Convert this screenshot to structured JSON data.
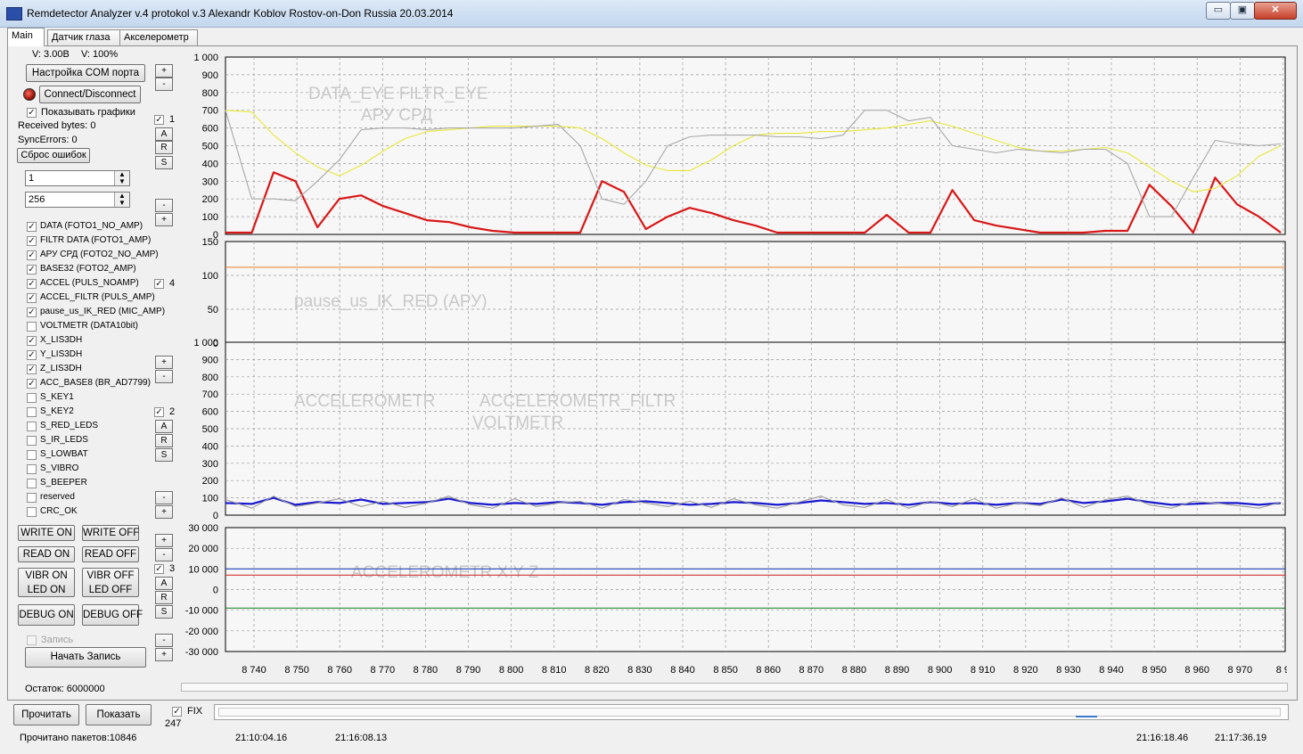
{
  "window": {
    "title": "Remdetector Analyzer v.4 protokol v.3 Alexandr Koblov Rostov-on-Don Russia 20.03.2014",
    "controls": [
      "▭",
      "▣",
      "✕"
    ]
  },
  "tabs": [
    {
      "label": "Main"
    },
    {
      "label": "Датчик глаза"
    },
    {
      "label": "Акселерометр"
    }
  ],
  "status_top": {
    "voltage": "V: 3.00В",
    "volume": "V: 100%"
  },
  "com_button": "Настройка COM порта",
  "connect_button": "Connect/Disconnect",
  "show_graphs": "Показывать графики",
  "received_bytes": "Received bytes: 0",
  "sync_errors": "SyncErrors: 0",
  "reset_errors": "Сброс ошибок",
  "spinners": [
    {
      "value": "1"
    },
    {
      "value": "256"
    }
  ],
  "channels": [
    {
      "label": "DATA (FOTO1_NO_AMP)",
      "checked": true
    },
    {
      "label": "FILTR DATA (FOTO1_AMP)",
      "checked": true
    },
    {
      "label": "АРУ СРД (FOTO2_NO_AMP)",
      "checked": true
    },
    {
      "label": "BASE32 (FOTO2_AMP)",
      "checked": true
    },
    {
      "label": "ACCEL (PULS_NOAMP)",
      "checked": true
    },
    {
      "label": "ACCEL_FILTR (PULS_AMP)",
      "checked": true
    },
    {
      "label": "pause_us_IK_RED (MIC_AMP)",
      "checked": true
    },
    {
      "label": "VOLTMETR (DATA10bit)",
      "checked": false
    },
    {
      "label": "X_LIS3DH",
      "checked": true
    },
    {
      "label": "Y_LIS3DH",
      "checked": true
    },
    {
      "label": "Z_LIS3DH",
      "checked": true
    },
    {
      "label": "ACC_BASE8 (BR_AD7799)",
      "checked": true
    },
    {
      "label": "S_KEY1",
      "checked": false
    },
    {
      "label": "S_KEY2",
      "checked": false
    },
    {
      "label": "S_RED_LEDS",
      "checked": false
    },
    {
      "label": "S_IR_LEDS",
      "checked": false
    },
    {
      "label": "S_LOWBAT",
      "checked": false
    },
    {
      "label": "S_VIBRO",
      "checked": false
    },
    {
      "label": "S_BEEPER",
      "checked": false
    },
    {
      "label": "reserved",
      "checked": false
    },
    {
      "label": "CRC_OK",
      "checked": false
    }
  ],
  "side_controls": {
    "plus": "+",
    "minus": "-",
    "a": "A",
    "r": "R",
    "s": "S",
    "num1": "1",
    "num4": "4",
    "num2": "2",
    "num3": "3"
  },
  "command_buttons": {
    "write_on": "WRITE ON",
    "write_off": "WRITE OFF",
    "read_on": "READ ON",
    "read_off": "READ OFF",
    "vibr_on": "VIBR ON",
    "vibr_off": "VIBR OFF",
    "led_on": "LED ON",
    "led_off": "LED OFF",
    "debug_on": "DEBUG ON",
    "debug_off": "DEBUG OFF"
  },
  "record": {
    "checkbox_label": "Запись",
    "start_button": "Начать Запись"
  },
  "remaining": "Остаток: 6000000",
  "bottom": {
    "read_button": "Прочитать",
    "show_button": "Показать",
    "fix_label": "FIX",
    "fix_value": "247",
    "packets": "Прочитано пакетов:10846",
    "time1": "21:10:04.16",
    "time2": "21:16:08.13",
    "time3": "21:16:18.46",
    "time4": "21:17:36.19"
  },
  "chart_data": [
    {
      "type": "line",
      "watermark": [
        "DATA_EYE   FILTR_EYE",
        "АРУ СРД"
      ],
      "ylim": [
        0,
        1000
      ],
      "yticks": [
        "1 000",
        "900",
        "800",
        "700",
        "600",
        "500",
        "400",
        "300",
        "200",
        "100",
        "0"
      ],
      "x": [
        8734,
        8740,
        8745,
        8750,
        8755,
        8760,
        8765,
        8770,
        8775,
        8780,
        8785,
        8790,
        8795,
        8800,
        8805,
        8810,
        8815,
        8820,
        8825,
        8830,
        8835,
        8840,
        8845,
        8850,
        8855,
        8860,
        8865,
        8870,
        8875,
        8880,
        8885,
        8890,
        8895,
        8900,
        8905,
        8910,
        8915,
        8920,
        8925,
        8930,
        8935,
        8940,
        8945,
        8950,
        8955,
        8960,
        8965,
        8970,
        8975
      ],
      "series": [
        {
          "color": "#d81818",
          "values": [
            10,
            10,
            350,
            300,
            40,
            200,
            220,
            160,
            120,
            80,
            70,
            40,
            20,
            10,
            10,
            10,
            10,
            300,
            240,
            30,
            100,
            150,
            120,
            80,
            50,
            10,
            10,
            10,
            10,
            10,
            110,
            10,
            10,
            250,
            80,
            50,
            30,
            10,
            10,
            10,
            20,
            20,
            280,
            160,
            10,
            320,
            170,
            100,
            10
          ]
        },
        {
          "color": "#e8e838",
          "values": [
            700,
            690,
            560,
            460,
            380,
            330,
            390,
            470,
            540,
            580,
            590,
            600,
            610,
            610,
            610,
            610,
            600,
            540,
            460,
            390,
            360,
            360,
            420,
            500,
            560,
            570,
            570,
            580,
            580,
            590,
            600,
            620,
            640,
            610,
            570,
            530,
            490,
            470,
            470,
            480,
            490,
            460,
            380,
            300,
            240,
            260,
            330,
            440,
            500
          ]
        },
        {
          "color": "#a8a8a8",
          "values": [
            700,
            200,
            200,
            190,
            300,
            420,
            590,
            600,
            600,
            590,
            600,
            600,
            600,
            600,
            610,
            620,
            500,
            200,
            170,
            300,
            500,
            550,
            560,
            560,
            560,
            550,
            550,
            540,
            560,
            700,
            700,
            640,
            660,
            500,
            480,
            460,
            480,
            470,
            460,
            480,
            480,
            400,
            100,
            100,
            320,
            530,
            510,
            500,
            510
          ]
        }
      ]
    },
    {
      "type": "line",
      "watermark": [
        "pause_us_IK_RED (АРУ)"
      ],
      "ylim": [
        0,
        150
      ],
      "yticks": [
        "150",
        "100",
        "50",
        "0"
      ],
      "series": [
        {
          "color": "#f08020",
          "values": [
            112
          ]
        }
      ]
    },
    {
      "type": "line",
      "watermark": [
        "ACCELEROMETR",
        "ACCELEROMETR_FILTR",
        "VOLTMETR"
      ],
      "ylim": [
        0,
        1000
      ],
      "yticks": [
        "1 000",
        "900",
        "800",
        "700",
        "600",
        "500",
        "400",
        "300",
        "200",
        "100",
        "0"
      ],
      "series": [
        {
          "color": "#1818d0",
          "values": [
            70,
            65,
            100,
            60,
            75,
            70,
            90,
            65,
            70,
            75,
            95,
            70,
            60,
            70,
            65,
            75,
            70,
            60,
            75,
            80,
            70,
            60,
            65,
            75,
            70,
            60,
            70,
            85,
            75,
            65,
            70,
            60,
            75,
            65,
            70,
            60,
            70,
            65,
            90,
            70,
            80,
            95,
            75,
            60,
            65,
            70,
            70,
            60,
            70
          ]
        },
        {
          "color": "#9a9a9a",
          "values": [
            90,
            40,
            110,
            50,
            70,
            95,
            50,
            80,
            45,
            70,
            110,
            60,
            40,
            95,
            50,
            70,
            80,
            40,
            90,
            70,
            50,
            80,
            45,
            95,
            60,
            40,
            75,
            110,
            60,
            45,
            90,
            40,
            80,
            50,
            95,
            40,
            70,
            55,
            100,
            45,
            90,
            110,
            60,
            40,
            80,
            70,
            55,
            40,
            75
          ]
        }
      ]
    },
    {
      "type": "line",
      "watermark": [
        "ACCELEROMETR X Y Z"
      ],
      "ylim": [
        -30000,
        30000
      ],
      "yticks": [
        "30 000",
        "20 000",
        "10 000",
        "0",
        "-10 000",
        "-20 000",
        "-30 000"
      ],
      "series": [
        {
          "color": "#1f3fb8",
          "values": [
            10000
          ]
        },
        {
          "color": "#d83030",
          "values": [
            7000
          ]
        },
        {
          "color": "#2a8a3a",
          "values": [
            -9000
          ]
        }
      ]
    }
  ],
  "x_axis": {
    "ticks": [
      "8 740",
      "8 750",
      "8 760",
      "8 770",
      "8 780",
      "8 790",
      "8 800",
      "8 810",
      "8 820",
      "8 830",
      "8 840",
      "8 850",
      "8 860",
      "8 870",
      "8 880",
      "8 890",
      "8 900",
      "8 910",
      "8 920",
      "8 930",
      "8 940",
      "8 950",
      "8 960",
      "8 970",
      "8 9"
    ]
  }
}
